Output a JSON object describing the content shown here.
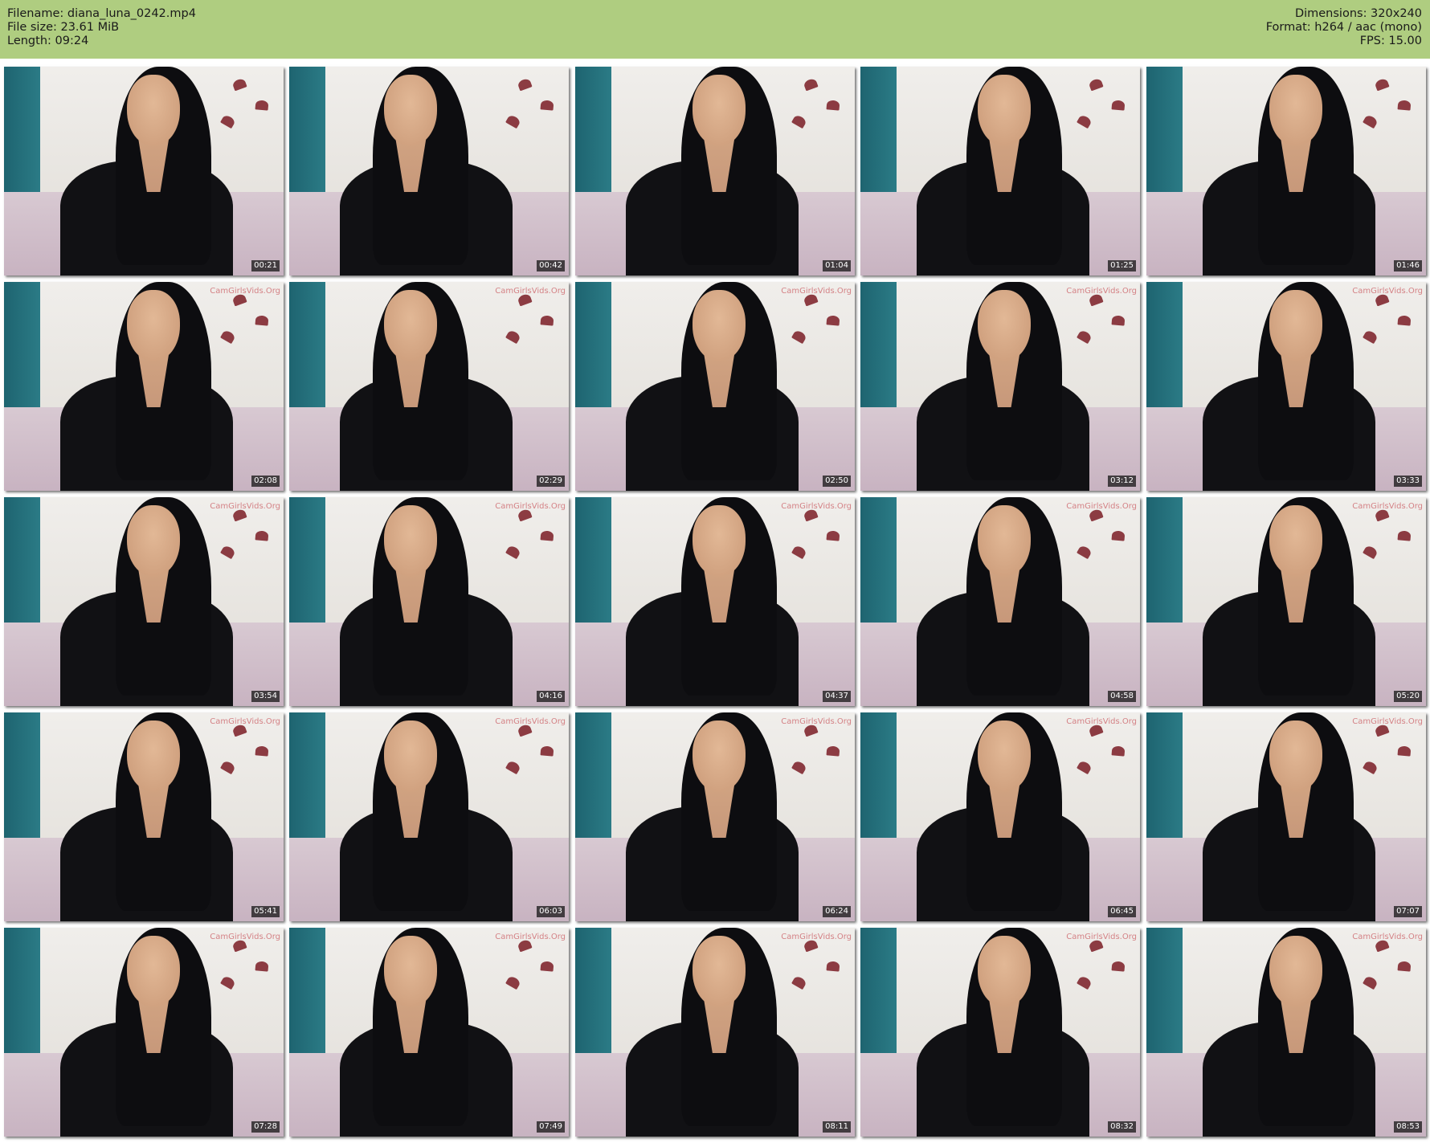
{
  "header": {
    "filename": "Filename: diana_luna_0242.mp4",
    "filesize": "File size: 23.61 MiB",
    "length": "Length: 09:24",
    "dimensions": "Dimensions: 320x240",
    "format": "Format: h264 / aac (mono)",
    "fps": "FPS: 15.00"
  },
  "colors": {
    "header_background": "#afcd80",
    "page_background": "#ffffff"
  },
  "thumbnails": [
    {
      "timestamp": "00:21",
      "watermark": ""
    },
    {
      "timestamp": "00:42",
      "watermark": ""
    },
    {
      "timestamp": "01:04",
      "watermark": ""
    },
    {
      "timestamp": "01:25",
      "watermark": ""
    },
    {
      "timestamp": "01:46",
      "watermark": ""
    },
    {
      "timestamp": "02:08",
      "watermark": "CamGirlsVids.Org"
    },
    {
      "timestamp": "02:29",
      "watermark": "CamGirlsVids.Org"
    },
    {
      "timestamp": "02:50",
      "watermark": "CamGirlsVids.Org"
    },
    {
      "timestamp": "03:12",
      "watermark": "CamGirlsVids.Org"
    },
    {
      "timestamp": "03:33",
      "watermark": "CamGirlsVids.Org"
    },
    {
      "timestamp": "03:54",
      "watermark": "CamGirlsVids.Org"
    },
    {
      "timestamp": "04:16",
      "watermark": "CamGirlsVids.Org"
    },
    {
      "timestamp": "04:37",
      "watermark": "CamGirlsVids.Org"
    },
    {
      "timestamp": "04:58",
      "watermark": "CamGirlsVids.Org"
    },
    {
      "timestamp": "05:20",
      "watermark": "CamGirlsVids.Org"
    },
    {
      "timestamp": "05:41",
      "watermark": "CamGirlsVids.Org"
    },
    {
      "timestamp": "06:03",
      "watermark": "CamGirlsVids.Org"
    },
    {
      "timestamp": "06:24",
      "watermark": "CamGirlsVids.Org"
    },
    {
      "timestamp": "06:45",
      "watermark": "CamGirlsVids.Org"
    },
    {
      "timestamp": "07:07",
      "watermark": "CamGirlsVids.Org"
    },
    {
      "timestamp": "07:28",
      "watermark": "CamGirlsVids.Org"
    },
    {
      "timestamp": "07:49",
      "watermark": "CamGirlsVids.Org"
    },
    {
      "timestamp": "08:11",
      "watermark": "CamGirlsVids.Org"
    },
    {
      "timestamp": "08:32",
      "watermark": "CamGirlsVids.Org"
    },
    {
      "timestamp": "08:53",
      "watermark": "CamGirlsVids.Org"
    }
  ]
}
